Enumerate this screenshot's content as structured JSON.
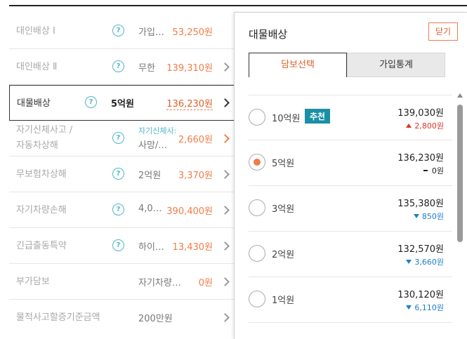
{
  "coverages": [
    {
      "name": "대인배상 Ⅰ",
      "option": "가입…",
      "price": "53,250원",
      "chevron": false
    },
    {
      "name": "대인배상 Ⅱ",
      "option": "무한",
      "price": "139,310원",
      "chevron": true
    },
    {
      "name": "대물배상",
      "option": "5억원",
      "price": "136,230원",
      "chevron": true,
      "active": true
    },
    {
      "name_line1": "자기신체사고 /",
      "name_line2": "자동차상해",
      "option_line1": "자기신체사:",
      "option_line2": "사망/…",
      "price": "2,660원",
      "chevron": true
    },
    {
      "name": "무보험차상해",
      "option": "2억원",
      "price": "3,370원",
      "chevron": true
    },
    {
      "name": "자기차량손해",
      "option": "4,0…",
      "price": "390,400원",
      "chevron": true
    },
    {
      "name": "긴급출동특약",
      "option": "하이…",
      "price": "13,430원",
      "chevron": true
    },
    {
      "name": "부가담보",
      "option": "자기차량…",
      "price": "0원",
      "chevron": true
    },
    {
      "name": "물적사고할증기준금액",
      "option": "200만원",
      "price": "",
      "chevron": true
    }
  ],
  "help_glyph": "?",
  "panel": {
    "title": "대물배상",
    "close_label": "닫기",
    "tabs": [
      "담보선택",
      "가입통계"
    ],
    "options": [
      {
        "label": "10억원",
        "badge": "추천",
        "price": "139,030원",
        "diff": "2,800원",
        "trend": "up",
        "checked": false
      },
      {
        "label": "5억원",
        "badge": "",
        "price": "136,230원",
        "diff": "0원",
        "trend": "flat",
        "checked": true
      },
      {
        "label": "3억원",
        "badge": "",
        "price": "135,380원",
        "diff": "850원",
        "trend": "down",
        "checked": false
      },
      {
        "label": "2억원",
        "badge": "",
        "price": "132,570원",
        "diff": "3,660원",
        "trend": "down",
        "checked": false
      },
      {
        "label": "1억원",
        "badge": "",
        "price": "130,120원",
        "diff": "6,110원",
        "trend": "down",
        "checked": false
      }
    ]
  },
  "colors": {
    "accent": "#f07d4a",
    "teal": "#4fb7c9",
    "badge": "#1a8fa6",
    "up": "#d9342b",
    "down": "#1e7fc4"
  }
}
